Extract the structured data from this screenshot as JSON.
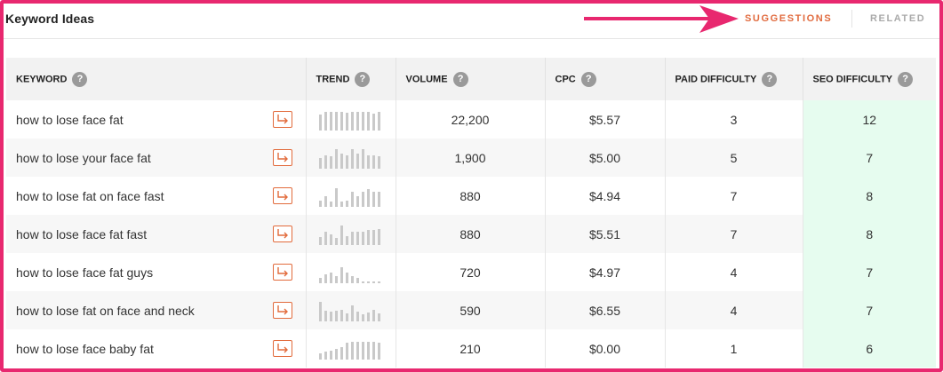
{
  "header": {
    "title": "Keyword Ideas",
    "tabs": [
      {
        "label": "SUGGESTIONS",
        "active": true
      },
      {
        "label": "RELATED",
        "active": false
      }
    ]
  },
  "colors": {
    "accent": "#e16b3f",
    "frame": "#e8286f",
    "seo_bg": "#e6fcef"
  },
  "table": {
    "columns": [
      "KEYWORD",
      "TREND",
      "VOLUME",
      "CPC",
      "PAID DIFFICULTY",
      "SEO DIFFICULTY"
    ],
    "help_icon": "?",
    "rows": [
      {
        "keyword": "how to lose face fat",
        "volume": "22,200",
        "cpc": "$5.57",
        "paid": "3",
        "seo": "12",
        "trend": [
          0.8,
          0.95,
          0.95,
          0.95,
          0.95,
          0.9,
          0.95,
          0.95,
          0.95,
          0.95,
          0.85,
          0.95
        ]
      },
      {
        "keyword": "how to lose your face fat",
        "volume": "1,900",
        "cpc": "$5.00",
        "paid": "5",
        "seo": "7",
        "trend": [
          0.55,
          0.7,
          0.65,
          1.0,
          0.75,
          0.7,
          1.0,
          0.75,
          1.0,
          0.7,
          0.7,
          0.65
        ]
      },
      {
        "keyword": "how to lose fat on face fast",
        "volume": "880",
        "cpc": "$4.94",
        "paid": "7",
        "seo": "8",
        "trend": [
          0.3,
          0.55,
          0.25,
          0.95,
          0.25,
          0.3,
          0.75,
          0.55,
          0.75,
          0.9,
          0.75,
          0.75
        ]
      },
      {
        "keyword": "how to lose face fat fast",
        "volume": "880",
        "cpc": "$5.51",
        "paid": "7",
        "seo": "8",
        "trend": [
          0.4,
          0.7,
          0.55,
          0.35,
          1.0,
          0.45,
          0.7,
          0.7,
          0.7,
          0.75,
          0.75,
          0.8
        ]
      },
      {
        "keyword": "how to lose face fat guys",
        "volume": "720",
        "cpc": "$4.97",
        "paid": "4",
        "seo": "7",
        "trend": [
          0.25,
          0.45,
          0.55,
          0.35,
          0.8,
          0.55,
          0.35,
          0.25,
          0.1,
          0.1,
          0.1,
          0.1
        ]
      },
      {
        "keyword": "how to lose fat on face and neck",
        "volume": "590",
        "cpc": "$6.55",
        "paid": "4",
        "seo": "7",
        "trend": [
          1.0,
          0.55,
          0.5,
          0.55,
          0.6,
          0.4,
          0.8,
          0.5,
          0.35,
          0.45,
          0.6,
          0.4
        ]
      },
      {
        "keyword": "how to lose face baby fat",
        "volume": "210",
        "cpc": "$0.00",
        "paid": "1",
        "seo": "6",
        "trend": [
          0.3,
          0.4,
          0.45,
          0.55,
          0.65,
          0.85,
          0.9,
          0.9,
          0.9,
          0.9,
          0.9,
          0.85
        ]
      }
    ]
  }
}
